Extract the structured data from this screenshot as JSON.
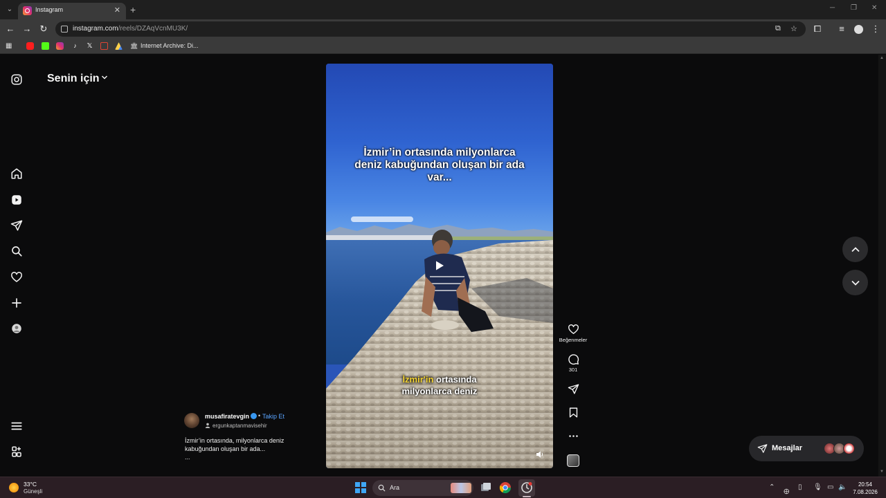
{
  "browser": {
    "tab_title": "Instagram",
    "tab_close": "✕",
    "new_tab": "+",
    "url_host": "instagram.com",
    "url_path": "/reels/DZAqVcnMU3K/",
    "bookmark_label": "Internet Archive: Di..."
  },
  "page": {
    "header_title": "Senin için",
    "sidebar_icons": [
      "instagram-logo-icon",
      "home-icon",
      "reels-icon",
      "direct-icon",
      "search-icon",
      "heart-icon",
      "create-icon",
      "profile-avatar",
      "menu-icon",
      "more-icon"
    ]
  },
  "reel": {
    "caption_line1": "İzmir’in ortasında milyonlarca",
    "caption_line2": "deniz kabuğundan oluşan bir ada",
    "caption_line3": "var...",
    "subtitle_highlight": "İzmir'in",
    "subtitle_rest": " ortasında",
    "subtitle_line2": "milyonlarca deniz",
    "author": "musafiratevgin",
    "follow_label": "Takip Et",
    "separator": "•",
    "collaborator": "ergunkaptanmavisehir",
    "description": "İzmir’in ortasında, milyonlarca deniz kabuğundan oluşan bir ada...",
    "description_more": "...",
    "likes_label": "Beğenmeler",
    "comments_count": "301"
  },
  "messages": {
    "label": "Mesajlar"
  },
  "taskbar": {
    "temperature": "33°C",
    "condition": "Güneşli",
    "search_placeholder": "Ara",
    "time": "20:54",
    "date": "7.08.2026"
  },
  "colors": {
    "accent": "#5aa4ff",
    "background": "#0b0b0c",
    "highlight": "#f4d331"
  }
}
